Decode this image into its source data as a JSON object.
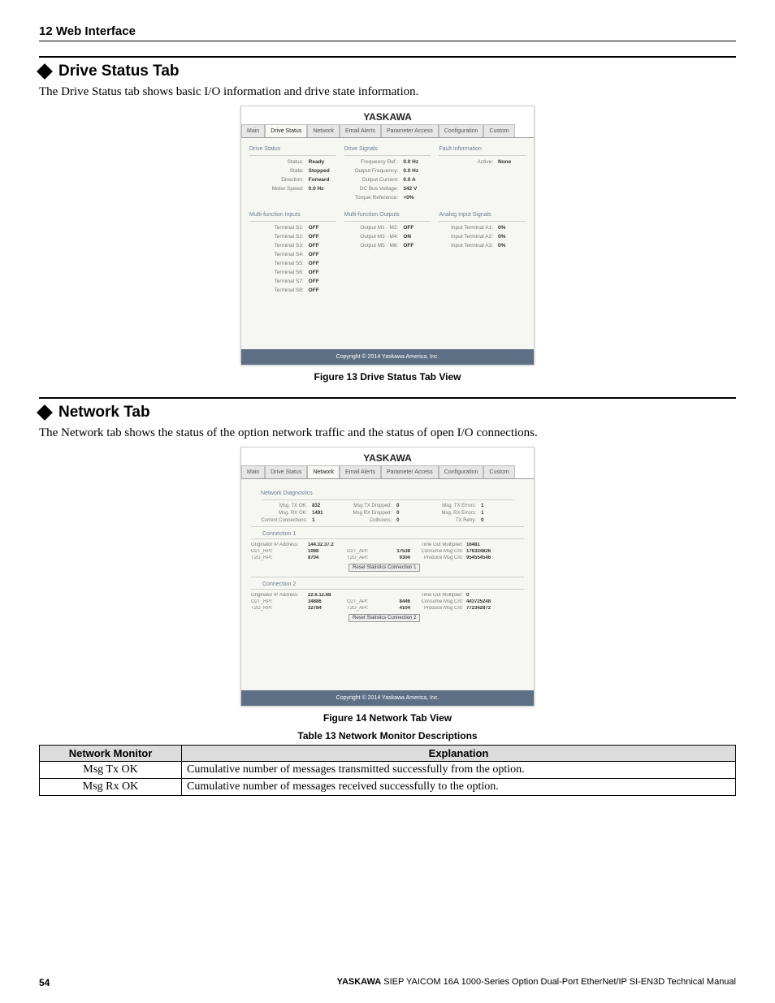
{
  "header": {
    "title": "12 Web Interface"
  },
  "sections": {
    "drivestatus": {
      "heading": "Drive Status Tab",
      "intro": "The Drive Status tab shows basic I/O information and drive state information.",
      "figure_caption": "Figure 13  Drive Status Tab View"
    },
    "networktab": {
      "heading": "Network Tab",
      "intro": "The Network tab shows the status of the option network traffic and the status of open I/O connections.",
      "figure_caption": "Figure 14  Network Tab View"
    }
  },
  "shot1": {
    "logo": "YASKAWA",
    "tabs": [
      "Main",
      "Drive Status",
      "Network",
      "Email Alerts",
      "Parameter Access",
      "Configuration",
      "Custom"
    ],
    "active_tab": 1,
    "cards": {
      "status": {
        "title": "Drive Status",
        "rows": [
          [
            "Status:",
            "Ready"
          ],
          [
            "State:",
            "Stopped"
          ],
          [
            "Direction:",
            "Forward"
          ],
          [
            "Motor Speed:",
            "0.0 Hz"
          ]
        ]
      },
      "signals": {
        "title": "Drive Signals",
        "rows": [
          [
            "Frequency Ref.:",
            "0.0 Hz"
          ],
          [
            "Output Frequency:",
            "0.0 Hz"
          ],
          [
            "Output Current:",
            "0.0 A"
          ],
          [
            "DC Bus Voltage:",
            "342 V"
          ],
          [
            "Torque Reference:",
            "+0%"
          ]
        ]
      },
      "fault": {
        "title": "Fault Information",
        "rows": [
          [
            "Active:",
            "None"
          ]
        ]
      },
      "mfin": {
        "title": "Multi-function Inputs",
        "rows": [
          [
            "Terminal S1:",
            "OFF"
          ],
          [
            "Terminal S2:",
            "OFF"
          ],
          [
            "Terminal S3:",
            "OFF"
          ],
          [
            "Terminal S4:",
            "OFF"
          ],
          [
            "Terminal S5:",
            "OFF"
          ],
          [
            "Terminal S6:",
            "OFF"
          ],
          [
            "Terminal S7:",
            "OFF"
          ],
          [
            "Terminal S8:",
            "OFF"
          ]
        ]
      },
      "mfout": {
        "title": "Multi-function Outputs",
        "rows": [
          [
            "Output M1 - M2:",
            "OFF"
          ],
          [
            "Output M3 - M4:",
            "ON"
          ],
          [
            "Output M5 - M6:",
            "OFF"
          ]
        ]
      },
      "ain": {
        "title": "Analog Input Signals",
        "rows": [
          [
            "Input Terminal A1:",
            "0%"
          ],
          [
            "Input Terminal A2:",
            "0%"
          ],
          [
            "Input Terminal A3:",
            "0%"
          ]
        ]
      }
    },
    "copyright": "Copyright © 2014 Yaskawa America, Inc."
  },
  "shot2": {
    "logo": "YASKAWA",
    "tabs": [
      "Main",
      "Drive Status",
      "Network",
      "Email Alerts",
      "Parameter Access",
      "Configuration",
      "Custom"
    ],
    "active_tab": 2,
    "diag": {
      "title": "Network Diagnostics",
      "rows": [
        [
          "Msg. TX OK:",
          "832",
          "Msg TX Dropped:",
          "0",
          "Msg. TX Errors:",
          "1"
        ],
        [
          "Msg. RX OK:",
          "1491",
          "Msg RX Dropped:",
          "0",
          "Msg. RX Errors:",
          "1"
        ],
        [
          "Current Connections:",
          "1",
          "Collisions:",
          "0",
          "TX Retry:",
          "0"
        ]
      ]
    },
    "conn1": {
      "title": "Connection 1",
      "rows": [
        [
          "Originator IP Address:",
          "144.32.37.2",
          "",
          "",
          "Time Out Multiplier:",
          "16481"
        ],
        [
          "O2T_RPI:",
          "1088",
          "O2T_API:",
          "17538",
          "Consume Msg Cnt:",
          "176324826"
        ],
        [
          "T2O_RPI:",
          "8704",
          "T2O_API:",
          "9304",
          "Produce Msg Cnt:",
          "954554546"
        ]
      ],
      "reset": "Reset Statistics Connection 1"
    },
    "conn2": {
      "title": "Connection 2",
      "rows": [
        [
          "Originator IP Address:",
          "22.6.12.68",
          "",
          "",
          "Time Out Multiplier:",
          "0"
        ],
        [
          "O2T_RPI:",
          "34886",
          "O2T_API:",
          "8446",
          "Consume Msg Cnt:",
          "443725248"
        ],
        [
          "T2O_RPI:",
          "32784",
          "T2O_API:",
          "4104",
          "Produce Msg Cnt:",
          "772342872"
        ]
      ],
      "reset": "Reset Statistics Connection 2"
    },
    "copyright": "Copyright © 2014 Yaskawa America, Inc."
  },
  "table13": {
    "caption": "Table 13  Network Monitor Descriptions",
    "headers": [
      "Network Monitor",
      "Explanation"
    ],
    "rows": [
      [
        "Msg Tx OK",
        "Cumulative number of messages transmitted successfully from the option."
      ],
      [
        "Msg Rx OK",
        "Cumulative number of messages received successfully to the option."
      ]
    ]
  },
  "footer": {
    "page": "54",
    "manual_bold": "YASKAWA",
    "manual_rest": " SIEP YAICOM 16A 1000-Series Option Dual-Port EtherNet/IP SI-EN3D Technical Manual"
  }
}
